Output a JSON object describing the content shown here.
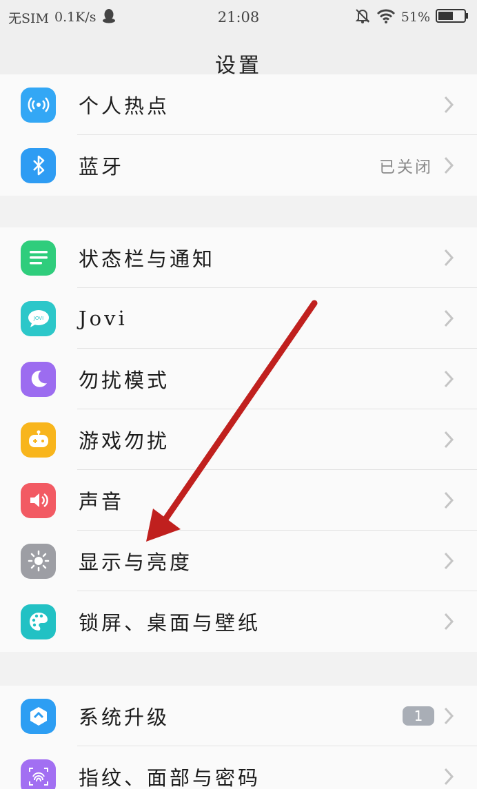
{
  "status_bar": {
    "sim": "无SIM",
    "speed": "0.1K/s",
    "time": "21:08",
    "battery": "51%",
    "icons": [
      "qq-icon",
      "bell-off-icon",
      "wifi-icon",
      "battery-icon"
    ]
  },
  "header": {
    "title": "设置"
  },
  "groups": [
    {
      "items": [
        {
          "label": "个人热点",
          "icon": "hotspot-icon",
          "color": "#33a7f5"
        },
        {
          "label": "蓝牙",
          "value": "已关闭",
          "icon": "bluetooth-icon",
          "color": "#2e9cf3"
        }
      ]
    },
    {
      "items": [
        {
          "label": "状态栏与通知",
          "icon": "status-bar-icon",
          "color": "#2fcd7c"
        },
        {
          "label": "Jovi",
          "icon": "jovi-icon",
          "color": "#2cc7c9"
        },
        {
          "label": "勿扰模式",
          "icon": "moon-icon",
          "color": "#9c6cf0"
        },
        {
          "label": "游戏勿扰",
          "icon": "game-icon",
          "color": "#f8b51c"
        },
        {
          "label": "声音",
          "icon": "speaker-icon",
          "color": "#f25a63"
        },
        {
          "label": "显示与亮度",
          "icon": "brightness-icon",
          "color": "#9d9ea4"
        },
        {
          "label": "锁屏、桌面与壁纸",
          "icon": "palette-icon",
          "color": "#22c1c4"
        }
      ]
    },
    {
      "items": [
        {
          "label": "系统升级",
          "badge": "1",
          "icon": "system-update-icon",
          "color": "#2d9ef3"
        },
        {
          "label": "指纹、面部与密码",
          "icon": "fingerprint-icon",
          "color": "#a26ff2"
        }
      ]
    }
  ],
  "annotation": {
    "arrow_color": "#c0201e"
  }
}
